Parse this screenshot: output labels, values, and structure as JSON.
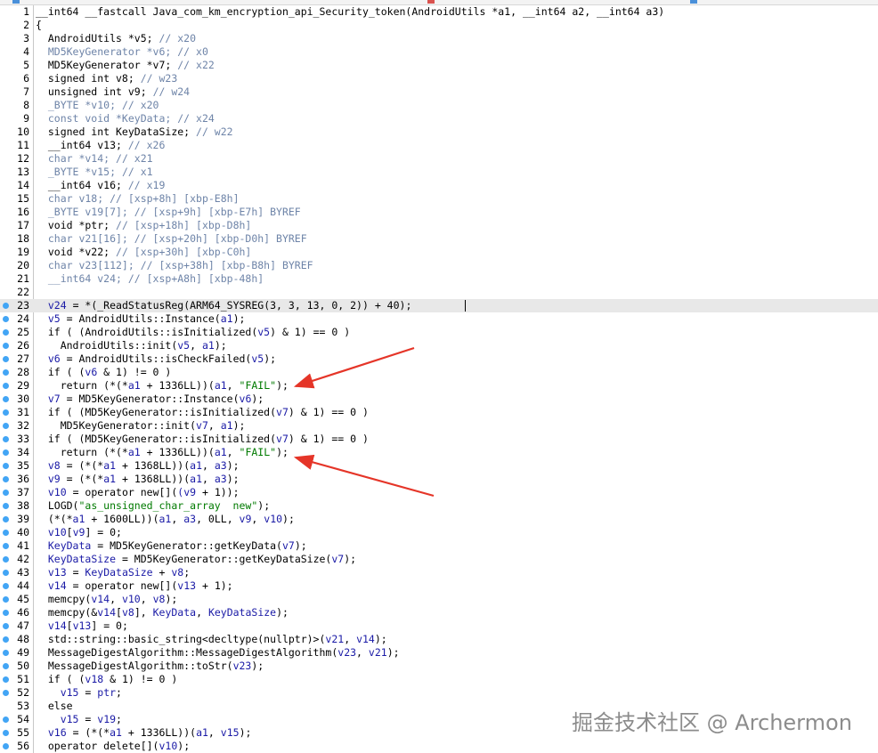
{
  "lines": [
    {
      "n": 1,
      "dot": false,
      "segs": [
        [
          "__int64 __fastcall Java_com_km_encryption_api_Security_token(AndroidUtils *a1, __int64 a2, __int64 a3)",
          ""
        ]
      ]
    },
    {
      "n": 2,
      "dot": false,
      "segs": [
        [
          "{",
          ""
        ]
      ]
    },
    {
      "n": 3,
      "dot": false,
      "segs": [
        [
          "  AndroidUtils *v5; ",
          ""
        ],
        [
          "// x20",
          "c"
        ]
      ]
    },
    {
      "n": 4,
      "dot": false,
      "segs": [
        [
          "  MD5KeyGenerator *v6; ",
          "g"
        ],
        [
          "// x0",
          "c"
        ]
      ]
    },
    {
      "n": 5,
      "dot": false,
      "segs": [
        [
          "  MD5KeyGenerator *v7; ",
          ""
        ],
        [
          "// x22",
          "c"
        ]
      ]
    },
    {
      "n": 6,
      "dot": false,
      "segs": [
        [
          "  signed int v8; ",
          ""
        ],
        [
          "// w23",
          "c"
        ]
      ]
    },
    {
      "n": 7,
      "dot": false,
      "segs": [
        [
          "  unsigned int v9; ",
          ""
        ],
        [
          "// w24",
          "c"
        ]
      ]
    },
    {
      "n": 8,
      "dot": false,
      "segs": [
        [
          "  _BYTE *v10; ",
          "g"
        ],
        [
          "// x20",
          "c"
        ]
      ]
    },
    {
      "n": 9,
      "dot": false,
      "segs": [
        [
          "  const void *KeyData; ",
          "g"
        ],
        [
          "// x24",
          "c"
        ]
      ]
    },
    {
      "n": 10,
      "dot": false,
      "segs": [
        [
          "  signed int KeyDataSize; ",
          ""
        ],
        [
          "// w22",
          "c"
        ]
      ]
    },
    {
      "n": 11,
      "dot": false,
      "segs": [
        [
          "  __int64 v13; ",
          ""
        ],
        [
          "// x26",
          "c"
        ]
      ]
    },
    {
      "n": 12,
      "dot": false,
      "segs": [
        [
          "  char *v14; ",
          "g"
        ],
        [
          "// x21",
          "c"
        ]
      ]
    },
    {
      "n": 13,
      "dot": false,
      "segs": [
        [
          "  _BYTE *v15; ",
          "g"
        ],
        [
          "// x1",
          "c"
        ]
      ]
    },
    {
      "n": 14,
      "dot": false,
      "segs": [
        [
          "  __int64 v16; ",
          ""
        ],
        [
          "// x19",
          "c"
        ]
      ]
    },
    {
      "n": 15,
      "dot": false,
      "segs": [
        [
          "  char v18; ",
          "g"
        ],
        [
          "// [xsp+8h] [xbp-E8h]",
          "c"
        ]
      ]
    },
    {
      "n": 16,
      "dot": false,
      "segs": [
        [
          "  _BYTE v19[7]; ",
          "g"
        ],
        [
          "// [xsp+9h] [xbp-E7h] BYREF",
          "c"
        ]
      ]
    },
    {
      "n": 17,
      "dot": false,
      "segs": [
        [
          "  void *ptr; ",
          ""
        ],
        [
          "// [xsp+18h] [xbp-D8h]",
          "c"
        ]
      ]
    },
    {
      "n": 18,
      "dot": false,
      "segs": [
        [
          "  char v21[16]; ",
          "g"
        ],
        [
          "// [xsp+20h] [xbp-D0h] BYREF",
          "c"
        ]
      ]
    },
    {
      "n": 19,
      "dot": false,
      "segs": [
        [
          "  void *v22; ",
          ""
        ],
        [
          "// [xsp+30h] [xbp-C0h]",
          "c"
        ]
      ]
    },
    {
      "n": 20,
      "dot": false,
      "segs": [
        [
          "  char v23[112]; ",
          "g"
        ],
        [
          "// [xsp+38h] [xbp-B8h] BYREF",
          "c"
        ]
      ]
    },
    {
      "n": 21,
      "dot": false,
      "segs": [
        [
          "  __int64 v24; ",
          "g"
        ],
        [
          "// [xsp+A8h] [xbp-48h]",
          "c"
        ]
      ]
    },
    {
      "n": 22,
      "dot": false,
      "segs": [
        [
          "",
          ""
        ]
      ]
    },
    {
      "n": 23,
      "dot": true,
      "current": true,
      "segs": [
        [
          "  ",
          ""
        ],
        [
          "v24",
          "v"
        ],
        [
          " = *(_ReadStatusReg(ARM64_SYSREG(3, 3, 13, 0, 2)) + 40);",
          ""
        ]
      ]
    },
    {
      "n": 24,
      "dot": true,
      "segs": [
        [
          "  ",
          ""
        ],
        [
          "v5",
          "v"
        ],
        [
          " = AndroidUtils::Instance(",
          ""
        ],
        [
          "a1",
          "v"
        ],
        [
          ");",
          ""
        ]
      ]
    },
    {
      "n": 25,
      "dot": true,
      "segs": [
        [
          "  if ( (AndroidUtils::isInitialized(",
          ""
        ],
        [
          "v5",
          "v"
        ],
        [
          ") & 1) == 0 )",
          ""
        ]
      ]
    },
    {
      "n": 26,
      "dot": true,
      "segs": [
        [
          "    AndroidUtils::init(",
          ""
        ],
        [
          "v5",
          "v"
        ],
        [
          ", ",
          ""
        ],
        [
          "a1",
          "v"
        ],
        [
          ");",
          ""
        ]
      ]
    },
    {
      "n": 27,
      "dot": true,
      "segs": [
        [
          "  ",
          ""
        ],
        [
          "v6",
          "v"
        ],
        [
          " = AndroidUtils::isCheckFailed(",
          ""
        ],
        [
          "v5",
          "v"
        ],
        [
          ");",
          ""
        ]
      ]
    },
    {
      "n": 28,
      "dot": true,
      "segs": [
        [
          "  if ( (",
          ""
        ],
        [
          "v6",
          "v"
        ],
        [
          " & 1) != 0 )",
          ""
        ]
      ]
    },
    {
      "n": 29,
      "dot": true,
      "segs": [
        [
          "    return (*(*",
          ""
        ],
        [
          "a1",
          "v"
        ],
        [
          " + 1336LL))(",
          ""
        ],
        [
          "a1",
          "v"
        ],
        [
          ", ",
          ""
        ],
        [
          "\"FAIL\"",
          "s"
        ],
        [
          ");",
          ""
        ]
      ]
    },
    {
      "n": 30,
      "dot": true,
      "segs": [
        [
          "  ",
          ""
        ],
        [
          "v7",
          "v"
        ],
        [
          " = MD5KeyGenerator::Instance(",
          ""
        ],
        [
          "v6",
          "v"
        ],
        [
          ");",
          ""
        ]
      ]
    },
    {
      "n": 31,
      "dot": true,
      "segs": [
        [
          "  if ( (MD5KeyGenerator::isInitialized(",
          ""
        ],
        [
          "v7",
          "v"
        ],
        [
          ") & 1) == 0 )",
          ""
        ]
      ]
    },
    {
      "n": 32,
      "dot": true,
      "segs": [
        [
          "    MD5KeyGenerator::init(",
          ""
        ],
        [
          "v7",
          "v"
        ],
        [
          ", ",
          ""
        ],
        [
          "a1",
          "v"
        ],
        [
          ");",
          ""
        ]
      ]
    },
    {
      "n": 33,
      "dot": true,
      "segs": [
        [
          "  if ( (MD5KeyGenerator::isInitialized(",
          ""
        ],
        [
          "v7",
          "v"
        ],
        [
          ") & 1) == 0 )",
          ""
        ]
      ]
    },
    {
      "n": 34,
      "dot": true,
      "segs": [
        [
          "    return (*(*",
          ""
        ],
        [
          "a1",
          "v"
        ],
        [
          " + 1336LL))(",
          ""
        ],
        [
          "a1",
          "v"
        ],
        [
          ", ",
          ""
        ],
        [
          "\"FAIL\"",
          "s"
        ],
        [
          ");",
          ""
        ]
      ]
    },
    {
      "n": 35,
      "dot": true,
      "segs": [
        [
          "  ",
          ""
        ],
        [
          "v8",
          "v"
        ],
        [
          " = (*(*",
          ""
        ],
        [
          "a1",
          "v"
        ],
        [
          " + 1368LL))(",
          ""
        ],
        [
          "a1",
          "v"
        ],
        [
          ", ",
          ""
        ],
        [
          "a3",
          "v"
        ],
        [
          ");",
          ""
        ]
      ]
    },
    {
      "n": 36,
      "dot": true,
      "segs": [
        [
          "  ",
          ""
        ],
        [
          "v9",
          "v"
        ],
        [
          " = (*(*",
          ""
        ],
        [
          "a1",
          "v"
        ],
        [
          " + 1368LL))(",
          ""
        ],
        [
          "a1",
          "v"
        ],
        [
          ", ",
          ""
        ],
        [
          "a3",
          "v"
        ],
        [
          ");",
          ""
        ]
      ]
    },
    {
      "n": 37,
      "dot": true,
      "segs": [
        [
          "  ",
          ""
        ],
        [
          "v10",
          "v"
        ],
        [
          " = operator new[](",
          ""
        ],
        [
          "(v9",
          "v"
        ],
        [
          " + 1));",
          ""
        ]
      ]
    },
    {
      "n": 38,
      "dot": true,
      "segs": [
        [
          "  LOGD(",
          ""
        ],
        [
          "\"as_unsigned_char_array  new\"",
          "s"
        ],
        [
          ");",
          ""
        ]
      ]
    },
    {
      "n": 39,
      "dot": true,
      "segs": [
        [
          "  (*(*",
          ""
        ],
        [
          "a1",
          "v"
        ],
        [
          " + 1600LL))(",
          ""
        ],
        [
          "a1",
          "v"
        ],
        [
          ", ",
          ""
        ],
        [
          "a3",
          "v"
        ],
        [
          ", 0LL, ",
          ""
        ],
        [
          "v9",
          "v"
        ],
        [
          ", ",
          ""
        ],
        [
          "v10",
          "v"
        ],
        [
          ");",
          ""
        ]
      ]
    },
    {
      "n": 40,
      "dot": true,
      "segs": [
        [
          "  ",
          ""
        ],
        [
          "v10",
          "v"
        ],
        [
          "[",
          ""
        ],
        [
          "v9",
          "v"
        ],
        [
          "] = 0;",
          ""
        ]
      ]
    },
    {
      "n": 41,
      "dot": true,
      "segs": [
        [
          "  ",
          ""
        ],
        [
          "KeyData",
          "v"
        ],
        [
          " = MD5KeyGenerator::getKeyData(",
          ""
        ],
        [
          "v7",
          "v"
        ],
        [
          ");",
          ""
        ]
      ]
    },
    {
      "n": 42,
      "dot": true,
      "segs": [
        [
          "  ",
          ""
        ],
        [
          "KeyDataSize",
          "v"
        ],
        [
          " = MD5KeyGenerator::getKeyDataSize(",
          ""
        ],
        [
          "v7",
          "v"
        ],
        [
          ");",
          ""
        ]
      ]
    },
    {
      "n": 43,
      "dot": true,
      "segs": [
        [
          "  ",
          ""
        ],
        [
          "v13",
          "v"
        ],
        [
          " = ",
          ""
        ],
        [
          "KeyDataSize",
          "v"
        ],
        [
          " + ",
          ""
        ],
        [
          "v8",
          "v"
        ],
        [
          ";",
          ""
        ]
      ]
    },
    {
      "n": 44,
      "dot": true,
      "segs": [
        [
          "  ",
          ""
        ],
        [
          "v14",
          "v"
        ],
        [
          " = operator new[](",
          ""
        ],
        [
          "v13",
          "v"
        ],
        [
          " + 1);",
          ""
        ]
      ]
    },
    {
      "n": 45,
      "dot": true,
      "segs": [
        [
          "  memcpy(",
          ""
        ],
        [
          "v14",
          "v"
        ],
        [
          ", ",
          ""
        ],
        [
          "v10",
          "v"
        ],
        [
          ", ",
          ""
        ],
        [
          "v8",
          "v"
        ],
        [
          ");",
          ""
        ]
      ]
    },
    {
      "n": 46,
      "dot": true,
      "segs": [
        [
          "  memcpy(&",
          ""
        ],
        [
          "v14",
          "v"
        ],
        [
          "[",
          ""
        ],
        [
          "v8",
          "v"
        ],
        [
          "], ",
          ""
        ],
        [
          "KeyData",
          "v"
        ],
        [
          ", ",
          ""
        ],
        [
          "KeyDataSize",
          "v"
        ],
        [
          ");",
          ""
        ]
      ]
    },
    {
      "n": 47,
      "dot": true,
      "segs": [
        [
          "  ",
          ""
        ],
        [
          "v14",
          "v"
        ],
        [
          "[",
          ""
        ],
        [
          "v13",
          "v"
        ],
        [
          "] = 0;",
          ""
        ]
      ]
    },
    {
      "n": 48,
      "dot": true,
      "segs": [
        [
          "  std::string::basic_string<decltype(nullptr)>(",
          ""
        ],
        [
          "v21",
          "v"
        ],
        [
          ", ",
          ""
        ],
        [
          "v14",
          "v"
        ],
        [
          ");",
          ""
        ]
      ]
    },
    {
      "n": 49,
      "dot": true,
      "segs": [
        [
          "  MessageDigestAlgorithm::MessageDigestAlgorithm(",
          ""
        ],
        [
          "v23",
          "v"
        ],
        [
          ", ",
          ""
        ],
        [
          "v21",
          "v"
        ],
        [
          ");",
          ""
        ]
      ]
    },
    {
      "n": 50,
      "dot": true,
      "segs": [
        [
          "  MessageDigestAlgorithm::toStr(",
          ""
        ],
        [
          "v23",
          "v"
        ],
        [
          ");",
          ""
        ]
      ]
    },
    {
      "n": 51,
      "dot": true,
      "segs": [
        [
          "  if ( (",
          ""
        ],
        [
          "v18",
          "v"
        ],
        [
          " & 1) != 0 )",
          ""
        ]
      ]
    },
    {
      "n": 52,
      "dot": true,
      "segs": [
        [
          "    ",
          ""
        ],
        [
          "v15",
          "v"
        ],
        [
          " = ",
          ""
        ],
        [
          "ptr",
          "v"
        ],
        [
          ";",
          ""
        ]
      ]
    },
    {
      "n": 53,
      "dot": false,
      "segs": [
        [
          "  else",
          ""
        ]
      ]
    },
    {
      "n": 54,
      "dot": true,
      "segs": [
        [
          "    ",
          ""
        ],
        [
          "v15",
          "v"
        ],
        [
          " = ",
          ""
        ],
        [
          "v19",
          "v"
        ],
        [
          ";",
          ""
        ]
      ]
    },
    {
      "n": 55,
      "dot": true,
      "segs": [
        [
          "  ",
          ""
        ],
        [
          "v16",
          "v"
        ],
        [
          " = (*(*",
          ""
        ],
        [
          "a1",
          "v"
        ],
        [
          " + 1336LL))(",
          ""
        ],
        [
          "a1",
          "v"
        ],
        [
          ", ",
          ""
        ],
        [
          "v15",
          "v"
        ],
        [
          ");",
          ""
        ]
      ]
    },
    {
      "n": 56,
      "dot": true,
      "segs": [
        [
          "  operator delete[](",
          ""
        ],
        [
          "v10",
          "v"
        ],
        [
          ");",
          ""
        ]
      ]
    }
  ],
  "watermark": "掘金技术社区 @ Archermon",
  "colors": {
    "arrow": "#e53528",
    "bp_dot": "#42a5f5",
    "variable": "#1a1aa6",
    "comment": "#6e84a8",
    "string": "#007a00",
    "current_line": "#e8e8e8"
  },
  "icons": [
    "breakpoint-dot-icon",
    "annotation-arrow-icon"
  ]
}
